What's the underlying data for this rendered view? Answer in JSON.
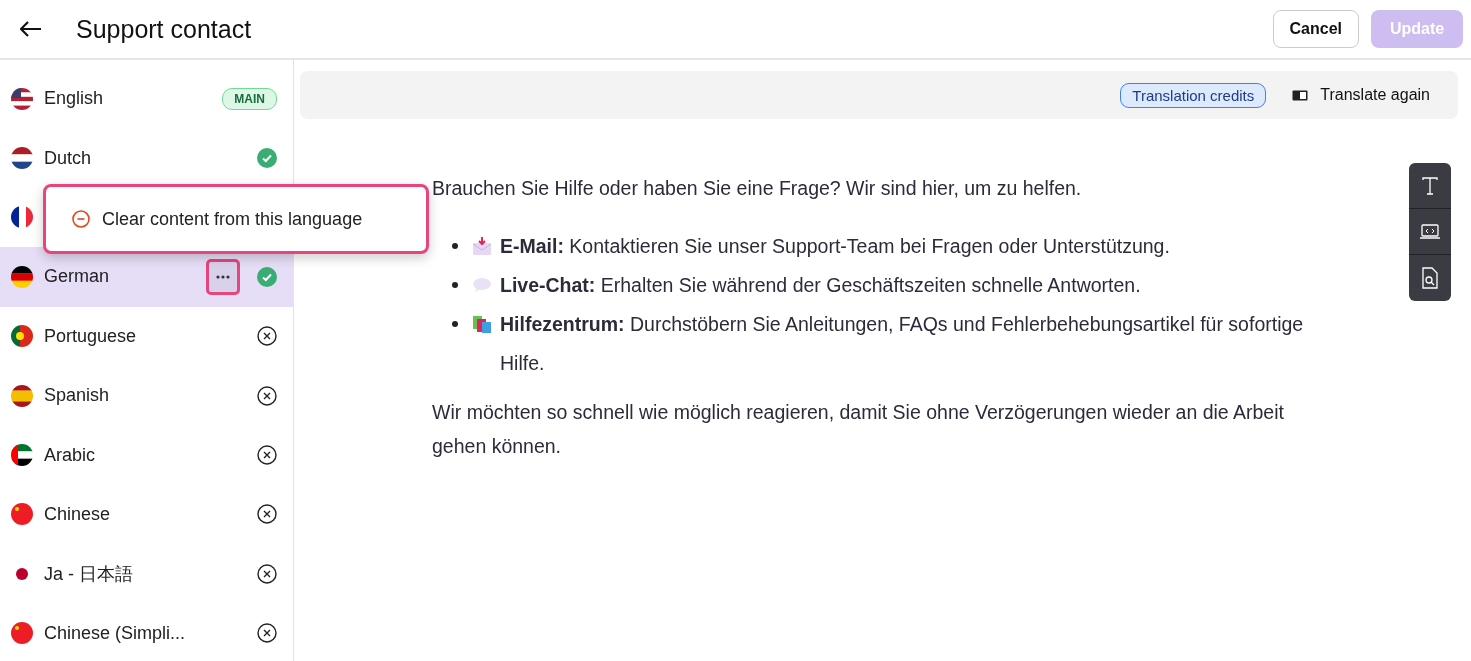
{
  "header": {
    "title": "Support contact",
    "buttons": [
      {
        "label": "Cancel",
        "kind": "secondary",
        "disabled": false
      },
      {
        "label": "Update",
        "kind": "primary",
        "disabled": true
      }
    ]
  },
  "languages": [
    {
      "name": "English",
      "kind": "main",
      "badge": "MAIN",
      "selected": false,
      "menu_open": false
    },
    {
      "name": "Dutch",
      "kind": "done",
      "selected": false,
      "menu_open": false
    },
    {
      "selected": false,
      "menu_open": false
    },
    {
      "name": "German",
      "kind": "done",
      "selected": true,
      "menu_open": true
    },
    {
      "name": "Portuguese",
      "kind": "missing",
      "selected": false,
      "menu_open": false
    },
    {
      "name": "Spanish",
      "kind": "missing",
      "selected": false,
      "menu_open": false
    },
    {
      "name": "Arabic",
      "kind": "missing",
      "selected": false,
      "menu_open": false
    },
    {
      "name": "Chinese",
      "kind": "missing",
      "selected": false,
      "menu_open": false
    },
    {
      "name": "Ja - 日本語",
      "kind": "missing",
      "selected": false,
      "menu_open": false
    },
    {
      "name": "Chinese (Simpli...",
      "kind": "missing",
      "selected": false,
      "menu_open": false
    }
  ],
  "context_menu": {
    "item": "Clear content from this language"
  },
  "toolbar": {
    "credits": "Translation credits",
    "translate": "Translate again"
  },
  "content": {
    "intro": "Brauchen Sie Hilfe oder haben Sie eine Frage? Wir sind hier, um zu helfen.",
    "bullets": [
      {
        "kind": "email",
        "text": "**E-Mail:** Kontaktieren Sie unser Support-Team bei Fragen oder Unterstützung."
      },
      {
        "kind": "chat",
        "text": "**Live-Chat:** Erhalten Sie während der Geschäftszeiten schnelle Antworten."
      },
      {
        "kind": "help",
        "text": "**Hilfezentrum:** Durchstöbern Sie Anleitungen, FAQs und Fehlerbehebungsartikel für sofortige Hilfe."
      }
    ],
    "outro": "Wir möchten so schnell wie möglich reagieren, damit Sie ohne Verzögerungen wieder an die Arbeit gehen können."
  }
}
